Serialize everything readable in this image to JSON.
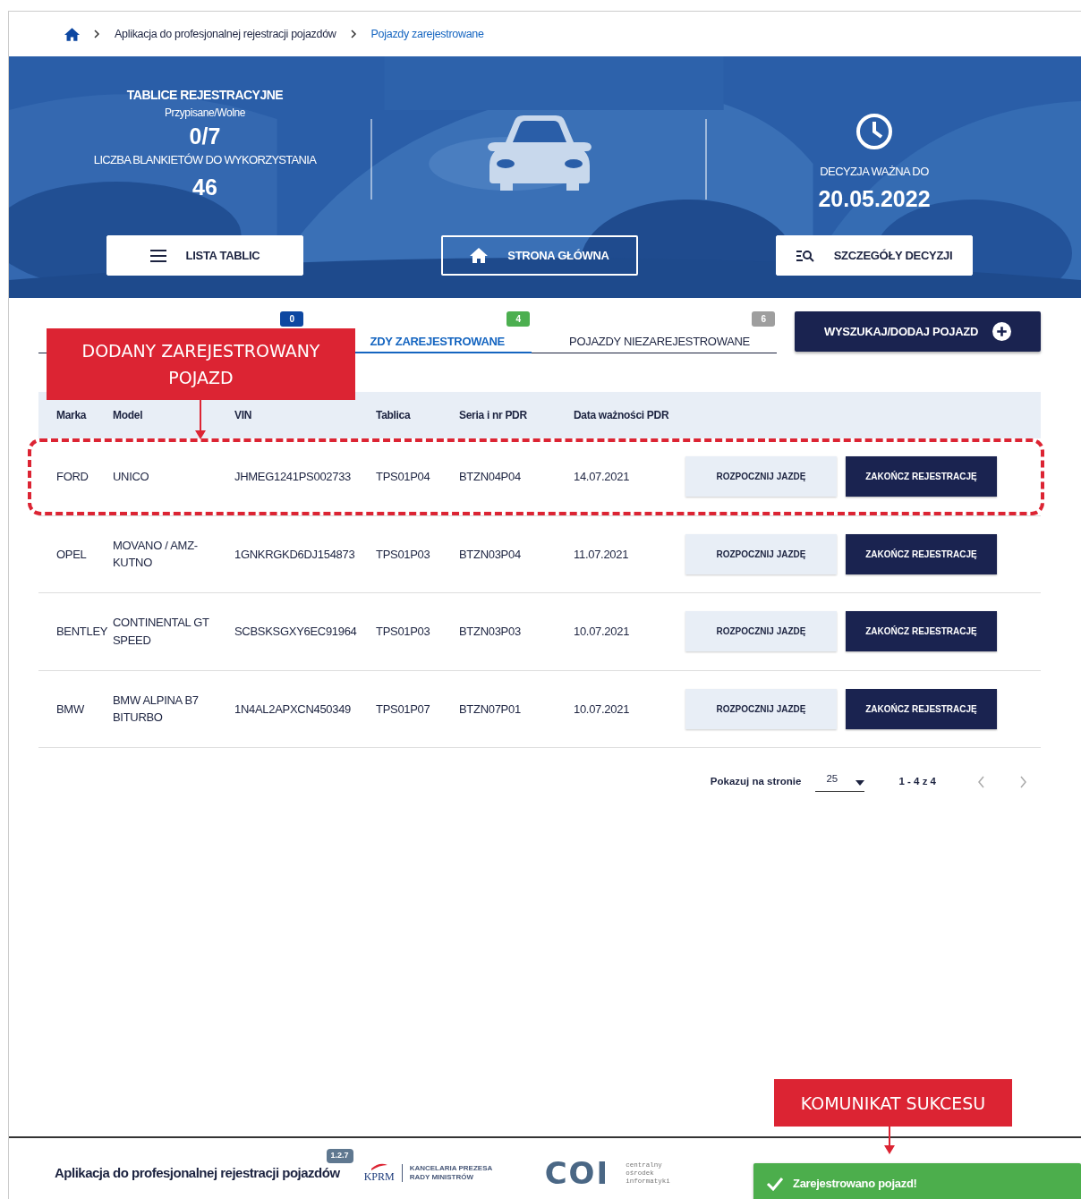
{
  "breadcrumb": {
    "items": [
      {
        "label": "Aplikacja do profesjonalnej rejestracji pojazdów",
        "current": false
      },
      {
        "label": "Pojazdy zarejestrowane",
        "current": true
      }
    ]
  },
  "hero": {
    "plates": {
      "title": "TABLICE REJESTRACYJNE",
      "subtitle": "Przypisane/Wolne",
      "value": "0/7"
    },
    "blanks": {
      "label": "LICZBA BLANKIETÓW DO WYKORZYSTANIA",
      "value": "46"
    },
    "decision": {
      "label": "DECYZJA WAŻNA DO",
      "value": "20.05.2022"
    },
    "buttons": [
      {
        "label": "LISTA TABLIC",
        "kind": "solid"
      },
      {
        "label": "STRONA GŁÓWNA",
        "kind": "outline"
      },
      {
        "label": "SZCZEGÓŁY DECYZJI",
        "kind": "solid"
      }
    ]
  },
  "tabs": [
    {
      "badge": "0",
      "color": "#0d47a1",
      "selected": false
    },
    {
      "label": "ZDY ZAREJESTROWANE",
      "badge": "4",
      "color": "#4caf50",
      "selected": true
    },
    {
      "label": "POJAZDY NIEZAREJESTROWANE",
      "badge": "6",
      "color": "#9e9e9e",
      "selected": false
    }
  ],
  "action_button": {
    "label": "WYSZUKAJ/DODAJ POJAZD"
  },
  "table": {
    "columns": [
      "Marka",
      "Model",
      "VIN",
      "Tablica",
      "Seria i nr PDR",
      "Data ważności PDR"
    ],
    "rows": [
      {
        "cells": [
          "FORD",
          "UNICO",
          "JHMEG1241PS002733",
          "TPS01P04",
          "BTZN04P04",
          "14.07.2021"
        ],
        "highlighted": true,
        "actions": [
          "ROZPOCZNIJ JAZDĘ",
          "ZAKOŃCZ REJESTRACJĘ"
        ]
      },
      {
        "cells": [
          "OPEL",
          "MOVANO / AMZ-KUTNO",
          "1GNKRGKD6DJ154873",
          "TPS01P03",
          "BTZN03P04",
          "11.07.2021"
        ],
        "highlighted": false,
        "actions": [
          "ROZPOCZNIJ JAZDĘ",
          "ZAKOŃCZ REJESTRACJĘ"
        ]
      },
      {
        "cells": [
          "BENTLEY",
          "CONTINENTAL GT SPEED",
          "SCBSKSGXY6EC91964",
          "TPS01P03",
          "BTZN03P03",
          "10.07.2021"
        ],
        "highlighted": false,
        "actions": [
          "ROZPOCZNIJ JAZDĘ",
          "ZAKOŃCZ REJESTRACJĘ"
        ]
      },
      {
        "cells": [
          "BMW",
          "BMW ALPINA B7 BITURBO",
          "1N4AL2APXCN450349",
          "TPS01P07",
          "BTZN07P01",
          "10.07.2021"
        ],
        "highlighted": false,
        "actions": [
          "ROZPOCZNIJ JAZDĘ",
          "ZAKOŃCZ REJESTRACJĘ"
        ]
      }
    ]
  },
  "pagination": {
    "label": "Pokazuj na stronie",
    "page_size": "25",
    "range": "1 - 4 z 4"
  },
  "footer": {
    "app_name": "Aplikacja do profesjonalnej rejestracji pojazdów",
    "version": "1.2.7",
    "kprm": "KPRM",
    "kprm_name": "KANCELARIA PREZESA RADY MINISTRÓW",
    "coi": "COI",
    "coi_name": "centralny ośrodek informatyki"
  },
  "toast": {
    "message": "Zarejestrowano pojazd!"
  },
  "callouts": [
    {
      "text": "DODANY ZAREJESTROWANY POJAZD"
    },
    {
      "text": "KOMUNIKAT SUKCESU"
    }
  ]
}
